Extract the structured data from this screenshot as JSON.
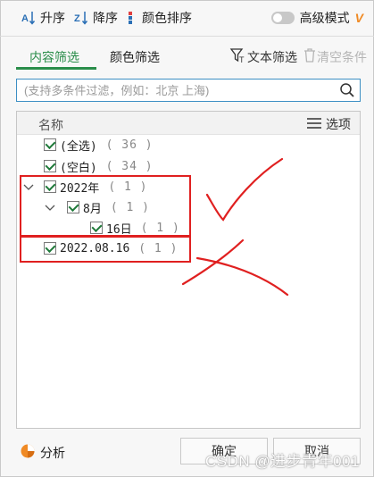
{
  "toolbar": {
    "sort_asc": "升序",
    "sort_desc": "降序",
    "color_sort": "颜色排序",
    "advanced_mode": "高级模式",
    "vip_badge": "V"
  },
  "tabs": {
    "content_filter": "内容筛选",
    "color_filter": "颜色筛选",
    "text_filter": "文本筛选",
    "clear_conditions": "清空条件"
  },
  "search": {
    "placeholder": "(支持多条件过滤，例如：北京 上海)",
    "value": ""
  },
  "list": {
    "header": "名称",
    "options_label": "选项",
    "items": [
      {
        "name": "(全选)",
        "count": "( 36 )"
      },
      {
        "name": "(空白)",
        "count": "( 34 )"
      },
      {
        "name": "2022年",
        "count": "( 1 )"
      },
      {
        "name": "8月",
        "count": "( 1 )"
      },
      {
        "name": "16日",
        "count": "( 1 )"
      },
      {
        "name": "2022.08.16",
        "count": "( 1 )"
      }
    ]
  },
  "footer": {
    "analyze": "分析",
    "confirm": "确定",
    "cancel": "取消"
  },
  "watermark": "CSDN @进步青年001",
  "colors": {
    "accent_green": "#2a8d4a",
    "annotation_red": "#e02020",
    "search_border": "#3d8fc4",
    "vip_orange": "#f08a24"
  },
  "icons": {
    "sort_asc": "sort-ascending-icon",
    "sort_desc": "sort-descending-icon",
    "color_sort": "color-sort-icon",
    "text_filter": "funnel-icon",
    "clear": "trash-icon",
    "search": "search-icon",
    "options": "menu-lines-icon",
    "analyze": "pie-chart-icon"
  }
}
